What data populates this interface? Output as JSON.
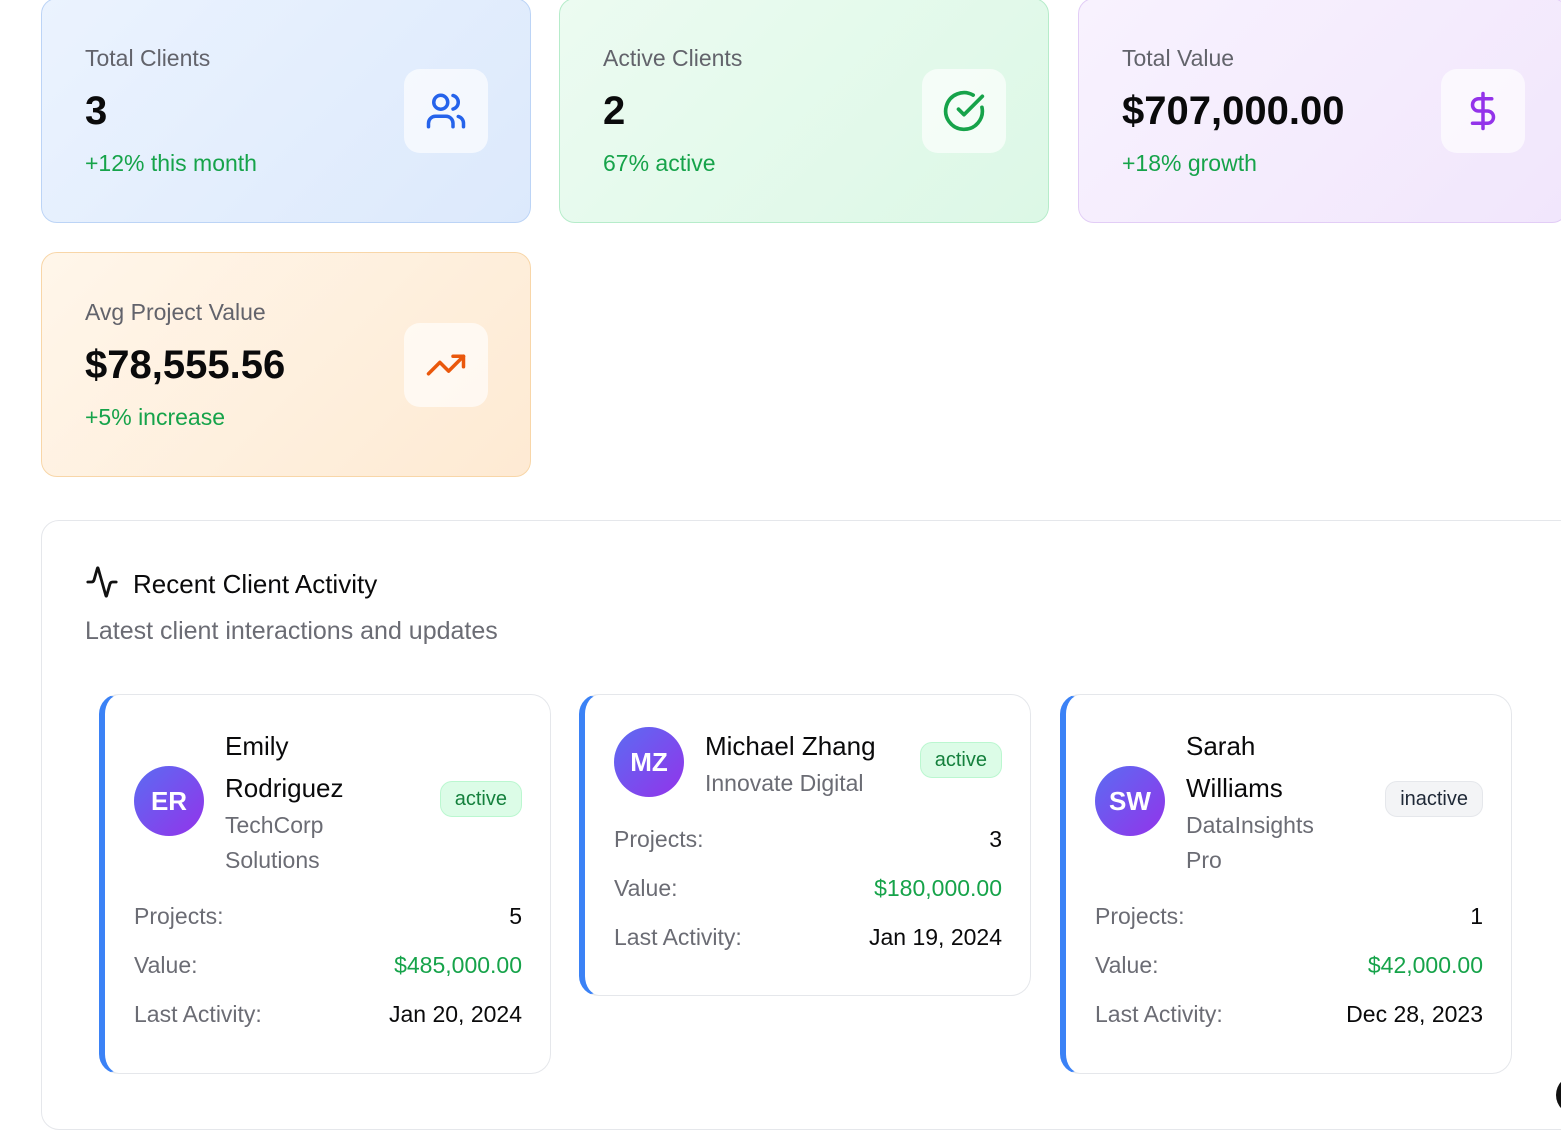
{
  "stats": [
    {
      "label": "Total Clients",
      "value": "3",
      "change": "+12% this month",
      "icon": "users-icon",
      "accent": "#2563eb"
    },
    {
      "label": "Active Clients",
      "value": "2",
      "change": "67% active",
      "icon": "check-circle-icon",
      "accent": "#16a34a"
    },
    {
      "label": "Total Value",
      "value": "$707,000.00",
      "change": "+18% growth",
      "icon": "dollar-icon",
      "accent": "#9333ea"
    },
    {
      "label": "Avg Project Value",
      "value": "$78,555.56",
      "change": "+5% increase",
      "icon": "trending-up-icon",
      "accent": "#ea580c"
    }
  ],
  "activity": {
    "title": "Recent Client Activity",
    "subtitle": "Latest client interactions and updates",
    "icon": "activity-icon",
    "labels": {
      "projects": "Projects:",
      "value": "Value:",
      "last_activity": "Last Activity:"
    },
    "clients": [
      {
        "initials": "ER",
        "name_line1": "Emily",
        "name_line2": "Rodriguez",
        "company_line1": "TechCorp",
        "company_line2": "Solutions",
        "status": "active",
        "projects": "5",
        "value": "$485,000.00",
        "last_activity": "Jan 20, 2024"
      },
      {
        "initials": "MZ",
        "name_line1": "Michael Zhang",
        "name_line2": "",
        "company_line1": "Innovate Digital",
        "company_line2": "",
        "status": "active",
        "projects": "3",
        "value": "$180,000.00",
        "last_activity": "Jan 19, 2024"
      },
      {
        "initials": "SW",
        "name_line1": "Sarah",
        "name_line2": "Williams",
        "company_line1": "DataInsights",
        "company_line2": "Pro",
        "status": "inactive",
        "projects": "1",
        "value": "$42,000.00",
        "last_activity": "Dec 28, 2023"
      }
    ]
  },
  "colors": {
    "status_active_bg": "#dcfce7",
    "status_inactive_bg": "#f3f4f6",
    "card_accent_border": "#3b82f6",
    "positive_text": "#16a34a"
  }
}
